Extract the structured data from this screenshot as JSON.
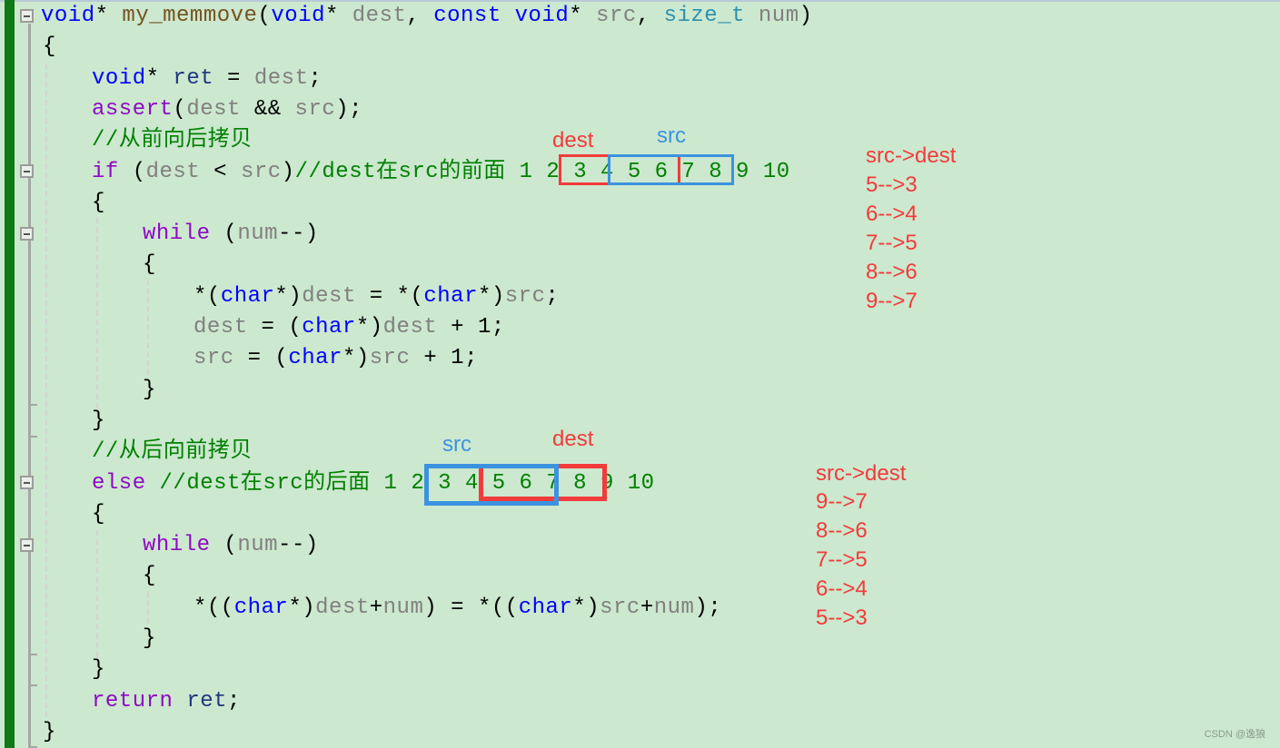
{
  "editor": {
    "lines": [
      {
        "indent": 0,
        "tokens": [
          [
            "kw",
            "void"
          ],
          [
            "pl",
            "* "
          ],
          [
            "fn",
            "my_memmove"
          ],
          [
            "pl",
            "("
          ],
          [
            "kw",
            "void"
          ],
          [
            "pl",
            "* "
          ],
          [
            "var",
            "dest"
          ],
          [
            "pl",
            ", "
          ],
          [
            "kw",
            "const void"
          ],
          [
            "pl",
            "* "
          ],
          [
            "var",
            "src"
          ],
          [
            "pl",
            ", "
          ],
          [
            "typ",
            "size_t"
          ],
          [
            "pl",
            " "
          ],
          [
            "var",
            "num"
          ],
          [
            "pl",
            ")"
          ]
        ]
      },
      {
        "indent": 0,
        "tokens": [
          [
            "brace",
            "{"
          ]
        ]
      },
      {
        "indent": 1,
        "tokens": [
          [
            "kw",
            "void"
          ],
          [
            "pl",
            "* "
          ],
          [
            "loc",
            "ret"
          ],
          [
            "pl",
            " = "
          ],
          [
            "var",
            "dest"
          ],
          [
            "pl",
            ";"
          ]
        ]
      },
      {
        "indent": 1,
        "tokens": [
          [
            "kw2",
            "assert"
          ],
          [
            "pl",
            "("
          ],
          [
            "var",
            "dest"
          ],
          [
            "pl",
            " && "
          ],
          [
            "var",
            "src"
          ],
          [
            "pl",
            ");"
          ]
        ]
      },
      {
        "indent": 1,
        "tokens": [
          [
            "cm",
            "//从前向后拷贝"
          ]
        ]
      },
      {
        "indent": 1,
        "tokens": [
          [
            "kw2",
            "if"
          ],
          [
            "pl",
            " ("
          ],
          [
            "var",
            "dest"
          ],
          [
            "pl",
            " < "
          ],
          [
            "var",
            "src"
          ],
          [
            "pl",
            ")"
          ],
          [
            "cm",
            "//dest在src的前面 1 2 3 4 5 6 7 8 9 10"
          ]
        ]
      },
      {
        "indent": 1,
        "tokens": [
          [
            "brace",
            "{"
          ]
        ]
      },
      {
        "indent": 2,
        "tokens": [
          [
            "kw2",
            "while"
          ],
          [
            "pl",
            " ("
          ],
          [
            "var",
            "num"
          ],
          [
            "pl",
            "--)"
          ]
        ]
      },
      {
        "indent": 2,
        "tokens": [
          [
            "brace",
            "{"
          ]
        ]
      },
      {
        "indent": 3,
        "tokens": [
          [
            "pl",
            "*("
          ],
          [
            "kw",
            "char"
          ],
          [
            "pl",
            "*)"
          ],
          [
            "var",
            "dest"
          ],
          [
            "pl",
            " = *("
          ],
          [
            "kw",
            "char"
          ],
          [
            "pl",
            "*)"
          ],
          [
            "var",
            "src"
          ],
          [
            "pl",
            ";"
          ]
        ]
      },
      {
        "indent": 3,
        "tokens": [
          [
            "var",
            "dest"
          ],
          [
            "pl",
            " = ("
          ],
          [
            "kw",
            "char"
          ],
          [
            "pl",
            "*)"
          ],
          [
            "var",
            "dest"
          ],
          [
            "pl",
            " + 1;"
          ]
        ]
      },
      {
        "indent": 3,
        "tokens": [
          [
            "var",
            "src"
          ],
          [
            "pl",
            " = ("
          ],
          [
            "kw",
            "char"
          ],
          [
            "pl",
            "*)"
          ],
          [
            "var",
            "src"
          ],
          [
            "pl",
            " + 1;"
          ]
        ]
      },
      {
        "indent": 2,
        "tokens": [
          [
            "brace",
            "}"
          ]
        ]
      },
      {
        "indent": 1,
        "tokens": [
          [
            "brace",
            "}"
          ]
        ]
      },
      {
        "indent": 1,
        "tokens": [
          [
            "cm",
            "//从后向前拷贝"
          ]
        ]
      },
      {
        "indent": 1,
        "tokens": [
          [
            "kw2",
            "else"
          ],
          [
            "pl",
            " "
          ],
          [
            "cm",
            "//dest在src的后面 1 2 3 4 5 6 7 8 9 10"
          ]
        ]
      },
      {
        "indent": 1,
        "tokens": [
          [
            "brace",
            "{"
          ]
        ]
      },
      {
        "indent": 2,
        "tokens": [
          [
            "kw2",
            "while"
          ],
          [
            "pl",
            " ("
          ],
          [
            "var",
            "num"
          ],
          [
            "pl",
            "--)"
          ]
        ]
      },
      {
        "indent": 2,
        "tokens": [
          [
            "brace",
            "{"
          ]
        ]
      },
      {
        "indent": 3,
        "tokens": [
          [
            "pl",
            "*(("
          ],
          [
            "kw",
            "char"
          ],
          [
            "pl",
            "*)"
          ],
          [
            "var",
            "dest"
          ],
          [
            "pl",
            "+"
          ],
          [
            "var",
            "num"
          ],
          [
            "pl",
            ") = *(("
          ],
          [
            "kw",
            "char"
          ],
          [
            "pl",
            "*)"
          ],
          [
            "var",
            "src"
          ],
          [
            "pl",
            "+"
          ],
          [
            "var",
            "num"
          ],
          [
            "pl",
            ");"
          ]
        ]
      },
      {
        "indent": 2,
        "tokens": [
          [
            "brace",
            "}"
          ]
        ]
      },
      {
        "indent": 1,
        "tokens": [
          [
            "brace",
            "}"
          ]
        ]
      },
      {
        "indent": 1,
        "tokens": [
          [
            "kw2",
            "return"
          ],
          [
            "pl",
            " "
          ],
          [
            "loc",
            "ret"
          ],
          [
            "pl",
            ";"
          ]
        ]
      },
      {
        "indent": 0,
        "tokens": [
          [
            "brace",
            "}"
          ]
        ]
      }
    ]
  },
  "annotations": {
    "forward": {
      "dest_label": "dest",
      "src_label": "src",
      "mapping_title": "src->dest",
      "mapping": [
        "5-->3",
        "6-->4",
        "7-->5",
        "8-->6",
        "9-->7"
      ]
    },
    "backward": {
      "src_label": "src",
      "dest_label": "dest",
      "mapping_title": "src->dest",
      "mapping": [
        "9-->7",
        "8-->6",
        "7-->5",
        "6-->4",
        "5-->3"
      ]
    }
  },
  "colors": {
    "background": "#cce8cf",
    "margin_bar": "#0f7a15",
    "annotation_red": "#f23b3b",
    "annotation_blue": "#3b93e0"
  },
  "watermark": "CSDN @逸狼"
}
